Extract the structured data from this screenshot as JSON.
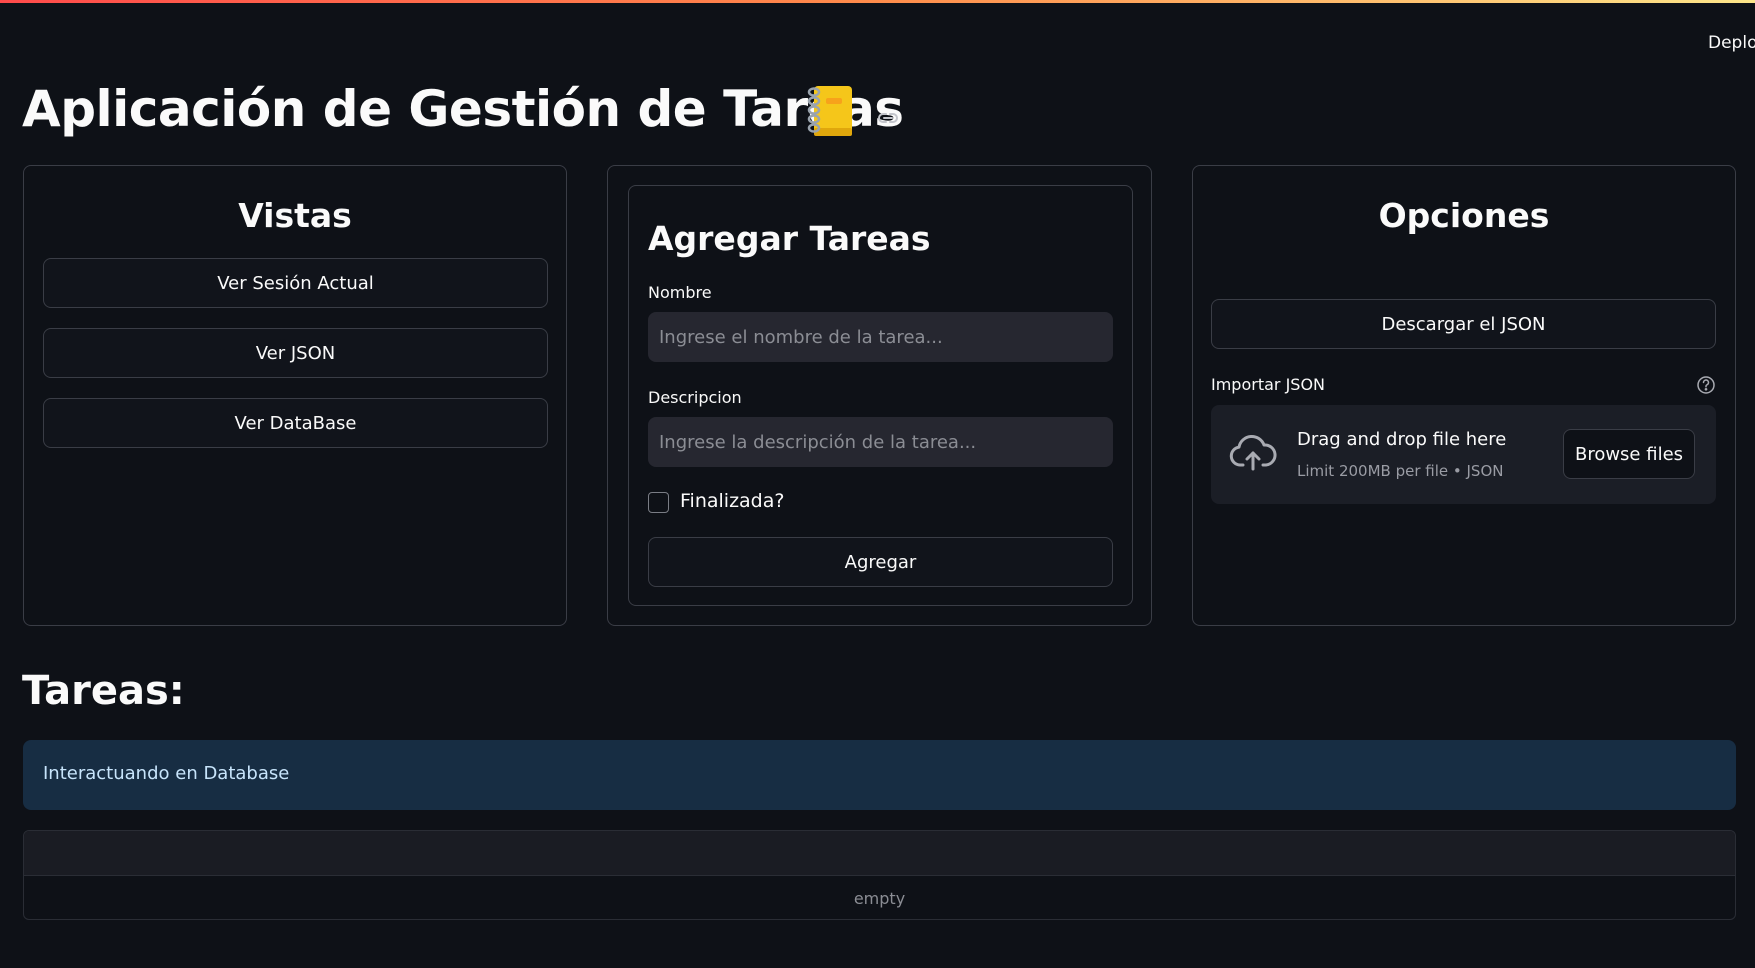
{
  "header": {
    "deploy_label": "Deploy"
  },
  "page": {
    "title": "Aplicación de Gestión de Tareas",
    "title_icon": "notebook-icon",
    "anchor_icon": "link-icon"
  },
  "vistas": {
    "heading": "Vistas",
    "buttons": [
      "Ver Sesión Actual",
      "Ver JSON",
      "Ver DataBase"
    ]
  },
  "agregar": {
    "heading": "Agregar Tareas",
    "nombre_label": "Nombre",
    "nombre_placeholder": "Ingrese el nombre de la tarea...",
    "nombre_value": "",
    "descripcion_label": "Descripcion",
    "descripcion_placeholder": "Ingrese la descripción de la tarea...",
    "descripcion_value": "",
    "finalizada_label": "Finalizada?",
    "finalizada_checked": false,
    "submit_label": "Agregar"
  },
  "opciones": {
    "heading": "Opciones",
    "download_label": "Descargar el JSON",
    "import_label": "Importar JSON",
    "dropzone_title": "Drag and drop file here",
    "dropzone_limit": "Limit 200MB per file • JSON",
    "browse_label": "Browse files"
  },
  "tareas": {
    "title": "Tareas:",
    "info_message": "Interactuando en Database",
    "table_empty_text": "empty"
  },
  "colors": {
    "background": "#0e1117",
    "input_bg": "#262730",
    "info_bg": "#172d43",
    "accent_gradient_start": "#ff4b4b",
    "accent_gradient_end": "#fde68a"
  }
}
